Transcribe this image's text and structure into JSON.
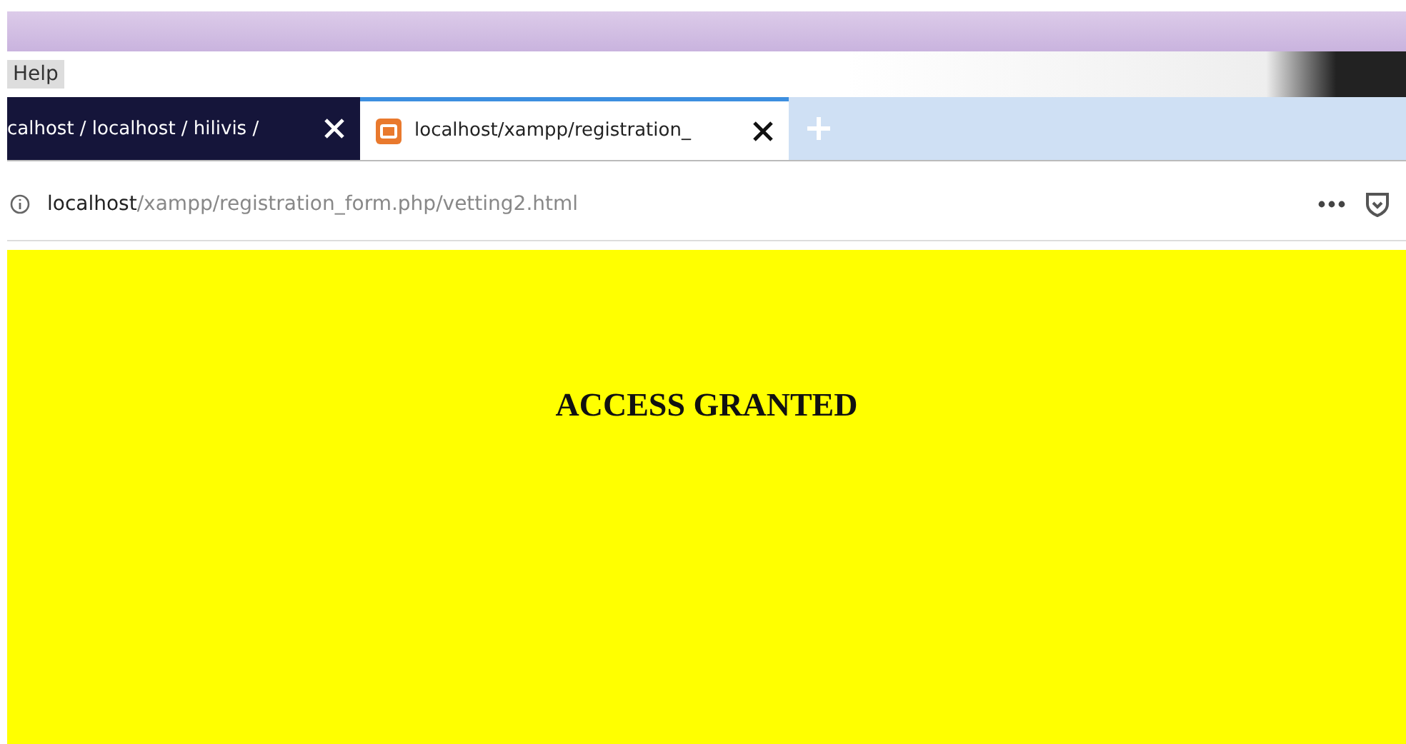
{
  "menu_bar": {
    "items": [
      "Help"
    ]
  },
  "tabs": [
    {
      "title": "calhost / localhost / hilivis /",
      "selected": false
    },
    {
      "title": "localhost/xampp/registration_",
      "selected": true
    }
  ],
  "address_bar": {
    "host": "localhost",
    "path": "/xampp/registration_form.php/vetting2.html"
  },
  "page": {
    "heading": "ACCESS GRANTED"
  }
}
